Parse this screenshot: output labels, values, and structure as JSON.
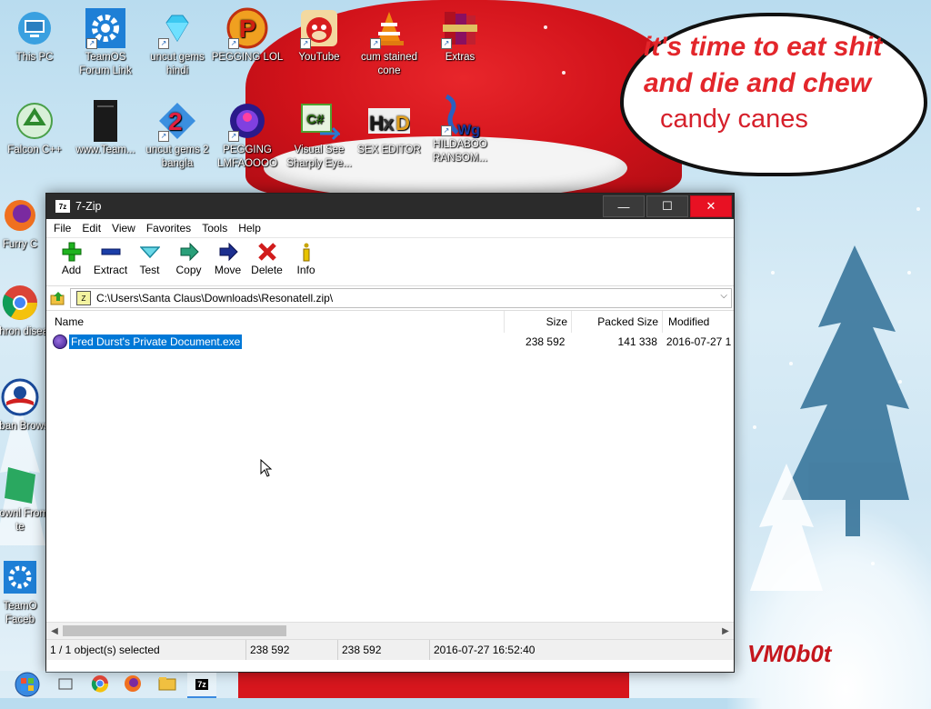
{
  "desktop": {
    "icons": [
      {
        "label": "This PC"
      },
      {
        "label": "TeamOS Forum Link"
      },
      {
        "label": "uncut gems hindi"
      },
      {
        "label": "PEGGING LOL"
      },
      {
        "label": "YouTube"
      },
      {
        "label": "cum stained cone"
      },
      {
        "label": "Extras"
      },
      {
        "label": "Falcon C++"
      },
      {
        "label": "www.Team..."
      },
      {
        "label": "uncut gems 2 bangla"
      },
      {
        "label": "PEGGING LMFAOOOO"
      },
      {
        "label": "Visual See Sharply Eye..."
      },
      {
        "label": "SEX EDITOR"
      },
      {
        "label": "HILDABOO RANSOM..."
      },
      {
        "label": "Furry C"
      },
      {
        "label": "Chron disea"
      },
      {
        "label": "Oban Brows"
      },
      {
        "label": "Downl From te"
      },
      {
        "label": "TeamO Faceb"
      }
    ],
    "speech_bubble": {
      "line1": "it's time to eat shit",
      "line2": "and die and chew",
      "line3": "candy canes"
    },
    "signature": "VM0b0t"
  },
  "window": {
    "title": "7-Zip",
    "app_icon": "7z",
    "controls": {
      "minimize": "—",
      "maximize": "☐",
      "close": "✕"
    },
    "menu": [
      "File",
      "Edit",
      "View",
      "Favorites",
      "Tools",
      "Help"
    ],
    "toolbar": [
      {
        "label": "Add",
        "icon": "plus-icon",
        "color": "#1fb31f"
      },
      {
        "label": "Extract",
        "icon": "minus-icon",
        "color": "#1b3ea8"
      },
      {
        "label": "Test",
        "icon": "check-icon",
        "color": "#1a9bb0"
      },
      {
        "label": "Copy",
        "icon": "copy-arrow-icon",
        "color": "#1d8f7a"
      },
      {
        "label": "Move",
        "icon": "move-arrow-icon",
        "color": "#1d2f8f"
      },
      {
        "label": "Delete",
        "icon": "delete-x-icon",
        "color": "#d11c1c"
      },
      {
        "label": "Info",
        "icon": "info-icon",
        "color": "#c8a400"
      }
    ],
    "address": "C:\\Users\\Santa Claus\\Downloads\\Resonatell.zip\\",
    "columns": {
      "name": "Name",
      "size": "Size",
      "packed": "Packed Size",
      "modified": "Modified"
    },
    "files": [
      {
        "name": "Fred Durst's Private Document.exe",
        "size": "238 592",
        "packed": "141 338",
        "modified": "2016-07-27 1"
      }
    ],
    "status": {
      "selection": "1 / 1 object(s) selected",
      "size": "238 592",
      "packed": "238 592",
      "date": "2016-07-27 16:52:40"
    }
  }
}
